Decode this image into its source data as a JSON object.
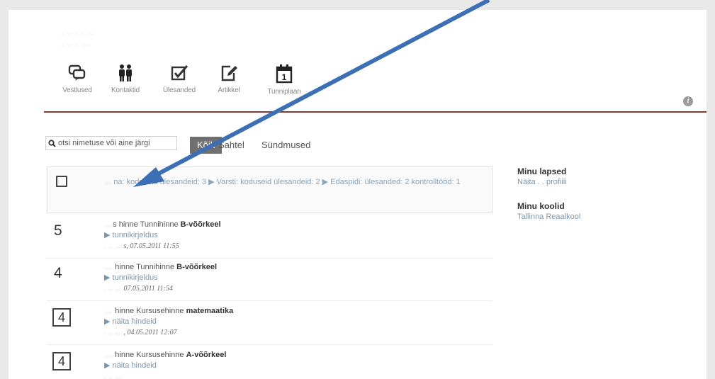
{
  "header": {
    "logo_line1": ". .. . . ..",
    "logo_line2": ". .. . ..."
  },
  "nav": [
    {
      "label": "Vestlused",
      "icon": "chat-icon"
    },
    {
      "label": "Kontaktid",
      "icon": "people-icon"
    },
    {
      "label": "Ülesanded",
      "icon": "tasks-icon"
    },
    {
      "label": "Artikkel",
      "icon": "article-icon"
    },
    {
      "label": "Tunniplaan",
      "icon": "calendar-icon"
    }
  ],
  "calendar_day": "1",
  "search": {
    "placeholder": "otsi nimetuse või aine järgi"
  },
  "filters": {
    "all": "Kõik",
    "mailbox": "Sahtel",
    "events": "Sündmused"
  },
  "summary": {
    "blurred": "...",
    "text": "na: koduseid ülesandeid: 3 ▶ Varsti: koduseid ülesandeid: 2 ▶ Edaspidi: ülesanded: 2 kontrolltööd: 1"
  },
  "feed": [
    {
      "grade": "5",
      "blurred_name": "....",
      "text": "s hinne Tunnihinne ",
      "subject": "B-võõrkeel",
      "link": "▶ tunnikirjeldus",
      "blurred_author": ". .. ...",
      "date": "s, 07.05.2011 11:55"
    },
    {
      "grade": "4",
      "blurred_name": "....",
      "text": " hinne Tunnihinne ",
      "subject": "B-võõrkeel",
      "link": "▶ tunnikirjeldus",
      "blurred_author": ". .. ...",
      "date": "07.05.2011 11:54"
    },
    {
      "grade": "4",
      "blurred_name": "....",
      "text": " hinne Kursusehinne ",
      "subject": "matemaatika",
      "link": "▶ näita hindeid",
      "blurred_author": ". .. ...",
      "date": ", 04.05.2011 12:07"
    },
    {
      "grade": "4",
      "blurred_name": "....",
      "text": " hinne Kursusehinne ",
      "subject": "A-võõrkeel",
      "link": "▶ näita hindeid",
      "blurred_author": ". .. ...",
      "date": ""
    }
  ],
  "sidebar": {
    "children_title": "Minu lapsed",
    "children_link": "Näita . . profiili",
    "schools_title": "Minu koolid",
    "school_link": "Tallinna Reaalkool"
  },
  "colors": {
    "divider": "#8b3a33",
    "link": "#7d97ad",
    "arrow": "#3d6fb4"
  }
}
